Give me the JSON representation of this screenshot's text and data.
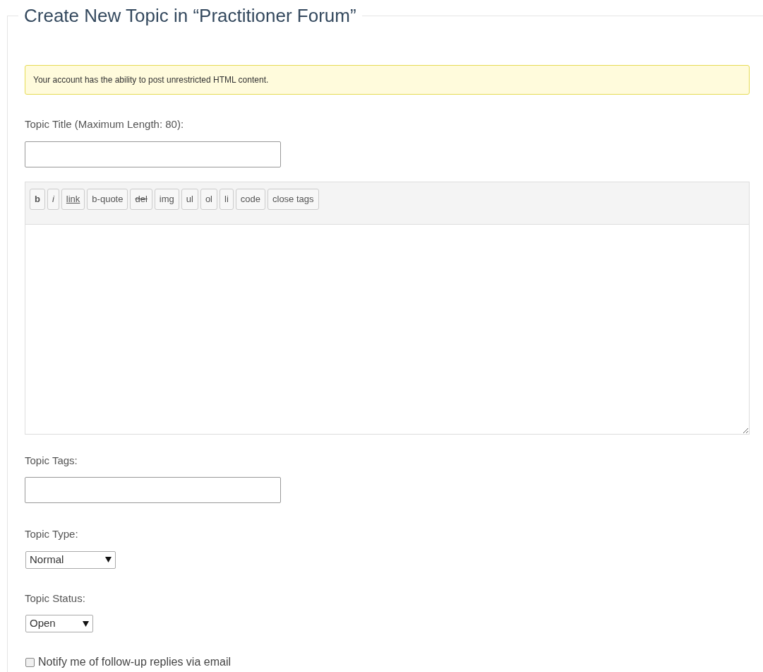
{
  "title": "Create New Topic in “Practitioner Forum”",
  "notice": "Your account has the ability to post unrestricted HTML content.",
  "topic_title": {
    "label": "Topic Title (Maximum Length: 80):"
  },
  "toolbar": [
    {
      "label": "b",
      "kind": "bold"
    },
    {
      "label": "i",
      "kind": "italic"
    },
    {
      "label": "link",
      "kind": "underline"
    },
    {
      "label": "b-quote",
      "kind": "plain"
    },
    {
      "label": "del",
      "kind": "strike"
    },
    {
      "label": "img",
      "kind": "plain"
    },
    {
      "label": "ul",
      "kind": "plain"
    },
    {
      "label": "ol",
      "kind": "plain"
    },
    {
      "label": "li",
      "kind": "plain"
    },
    {
      "label": "code",
      "kind": "plain"
    },
    {
      "label": "close tags",
      "kind": "plain"
    }
  ],
  "topic_tags": {
    "label": "Topic Tags:"
  },
  "topic_type": {
    "label": "Topic Type:",
    "value": "Normal"
  },
  "topic_status": {
    "label": "Topic Status:",
    "value": "Open"
  },
  "notify": {
    "label": "Notify me of follow-up replies via email",
    "checked": false
  }
}
